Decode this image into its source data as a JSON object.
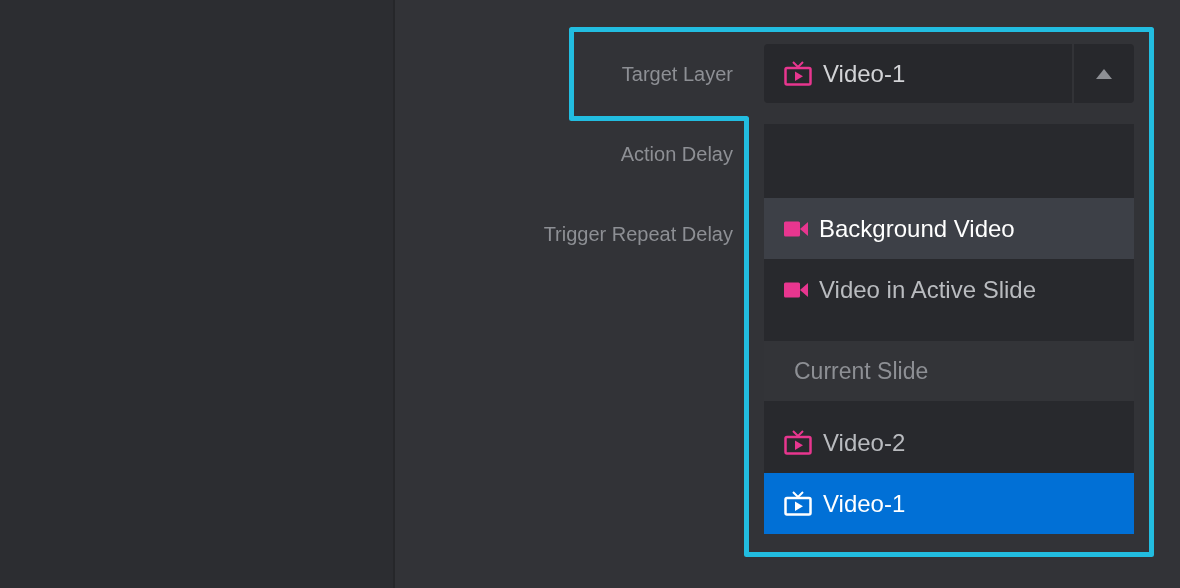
{
  "form": {
    "rows": [
      {
        "label": "Target Layer",
        "control": {
          "kind": "dropdown",
          "value": "Video-1",
          "expanded": true
        }
      },
      {
        "label": "Action Delay"
      },
      {
        "label": "Trigger Repeat Delay"
      }
    ]
  },
  "menu": {
    "items": [
      {
        "kind": "video",
        "label": "Background Video",
        "highlighted": true,
        "selected": false
      },
      {
        "kind": "video",
        "label": "Video in Active Slide",
        "highlighted": false,
        "selected": false
      },
      {
        "kind": "heading",
        "label": "Current Slide"
      },
      {
        "kind": "layer",
        "label": "Video-2",
        "highlighted": false,
        "selected": false
      },
      {
        "kind": "layer",
        "label": "Video-1",
        "highlighted": false,
        "selected": true
      }
    ]
  }
}
